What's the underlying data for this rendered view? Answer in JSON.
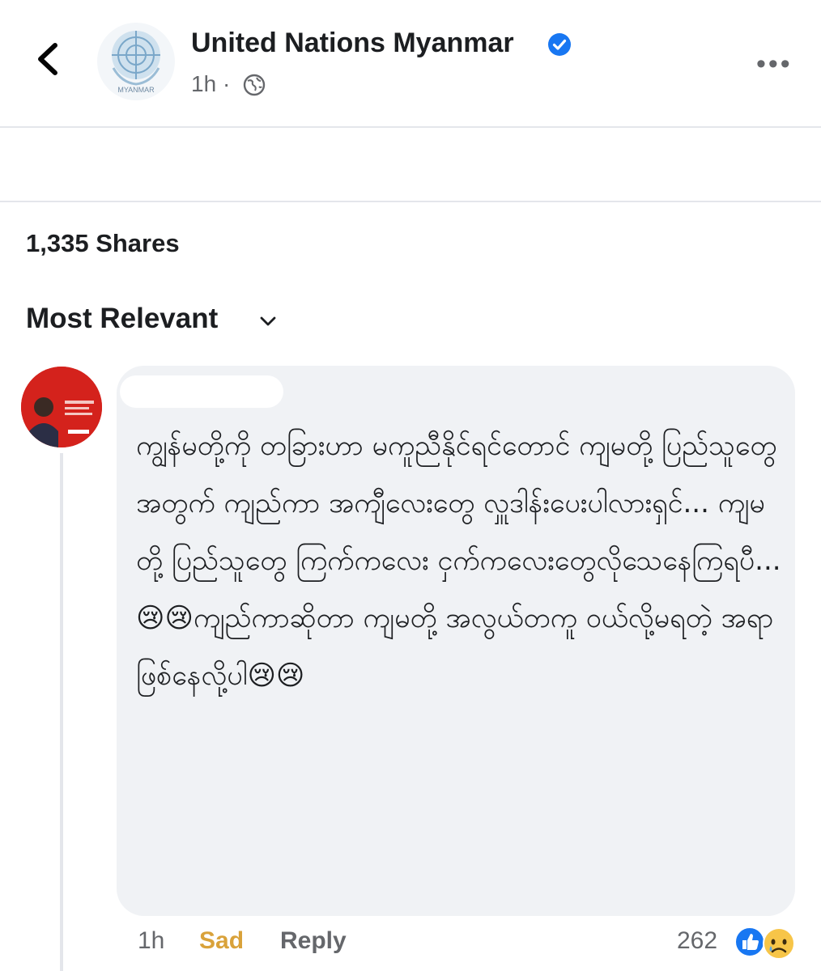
{
  "post": {
    "page_name": "United Nations Myanmar",
    "time": "1h",
    "separator": "·",
    "avatar_caption": "MYANMAR"
  },
  "stats": {
    "shares": "1,335 Shares"
  },
  "sort": {
    "label": "Most Relevant"
  },
  "comment": {
    "text": "ကျွန်မတို့ကို တခြားဟာ မကူညီနိုင်ရင်တောင် ကျမတို့ ပြည်သူတွေ အတွက် ကျည်ကာ အကျီလေးတွေ လှူဒါန်းပေးပါလားရှင်... ကျမတို့ ပြည်သူတွေ ကြက်ကလေး ငှက်ကလေးတွေလိုသေနေကြရပီ...😢😢ကျည်ကာဆိုတာ ကျမတို့ အလွယ်တကူ ဝယ်လို့မရတဲ့ အရာဖြစ်နေလို့ပါ😢😢",
    "time": "1h",
    "reaction_label": "Sad",
    "reply_label": "Reply",
    "reaction_count": "262"
  },
  "icons": {
    "back": "chevron-left-icon",
    "verified": "verified-badge-icon",
    "audience": "globe-icon",
    "more": "more-options-icon",
    "sort": "chevron-down-icon",
    "like": "like-reaction-icon",
    "sad": "sad-reaction-icon"
  },
  "colors": {
    "accent": "#1877f2",
    "sad_reaction": "#d9a23a",
    "avatar_red": "#d4221c",
    "bubble": "#f0f2f5"
  }
}
